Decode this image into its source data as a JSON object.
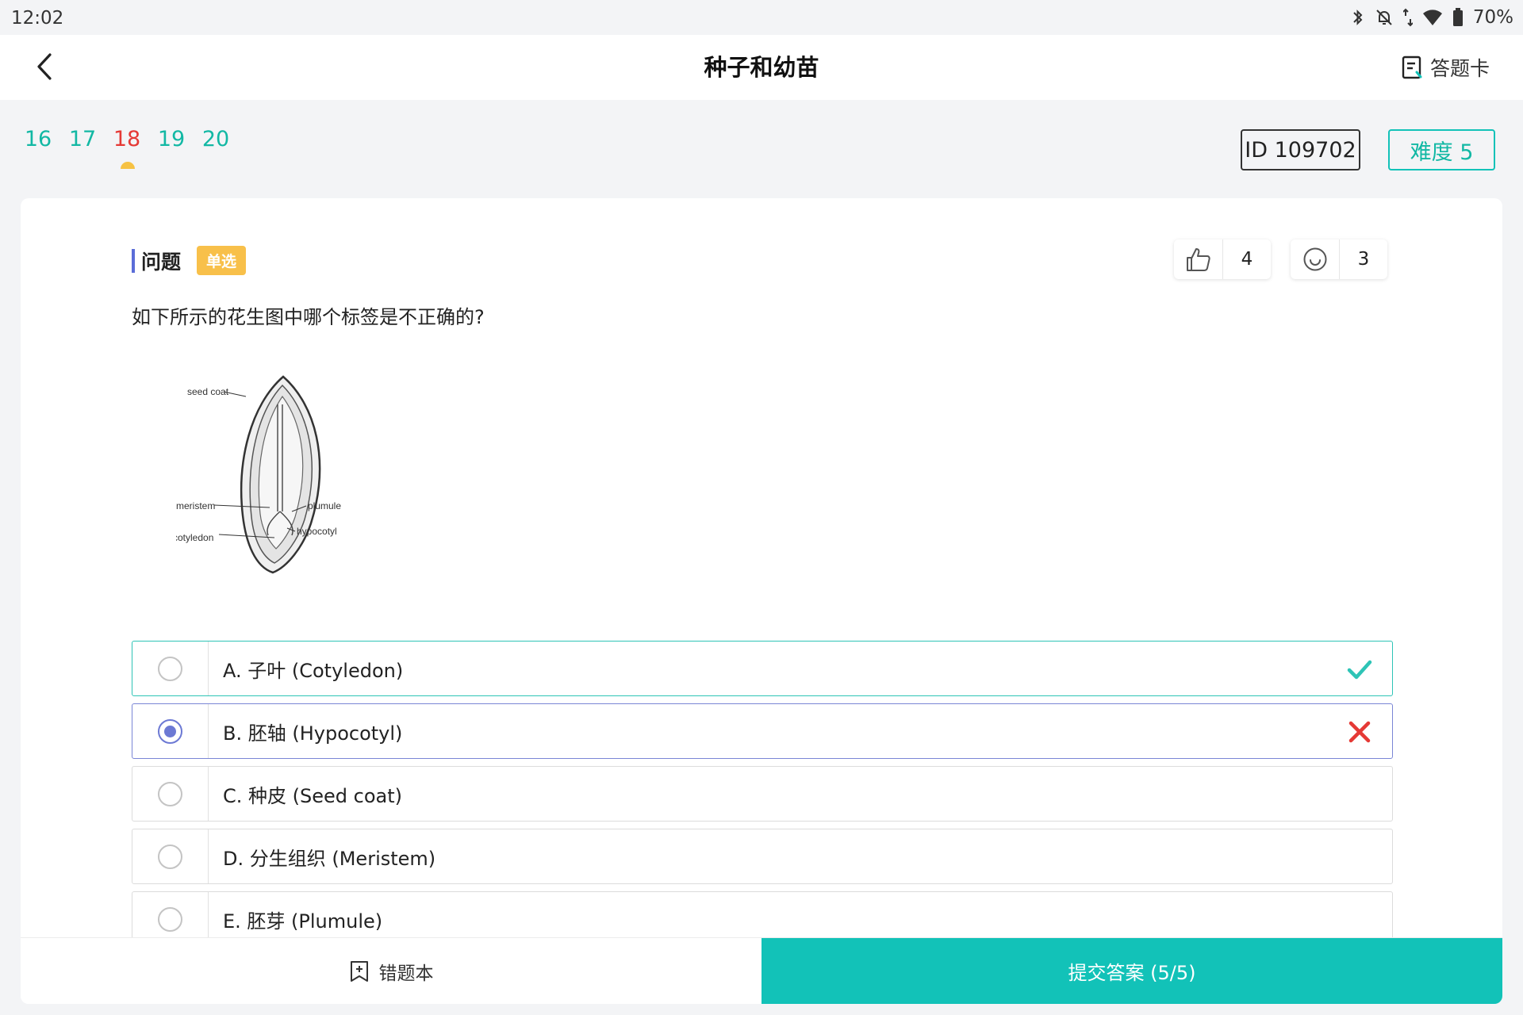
{
  "status_bar": {
    "time": "12:02",
    "battery": "70%",
    "icons": [
      "bluetooth-icon",
      "notifications-off-icon",
      "data-arrows-icon",
      "wifi-icon",
      "battery-icon"
    ]
  },
  "header": {
    "title": "种子和幼苗",
    "answer_card_label": "答题卡"
  },
  "question_nav": {
    "numbers": [
      "16",
      "17",
      "18",
      "19",
      "20"
    ],
    "current": "18"
  },
  "badges": {
    "id_label": "ID 109702",
    "difficulty_label": "难度 5"
  },
  "question": {
    "section_label": "问题",
    "type_label": "单选",
    "likes": "4",
    "smiles": "3",
    "text": "如下所示的花生图中哪个标签是不正确的?",
    "figure_labels": {
      "seed_coat": "seed coat",
      "meristem": "meristem",
      "plumule": "plumule",
      "hypocotyl": "hypocotyl",
      "cotyledon": "cotyledon"
    }
  },
  "options": [
    {
      "text": "A. 子叶 (Cotyledon)",
      "state": "correct",
      "selected": false
    },
    {
      "text": "B. 胚轴 (Hypocotyl)",
      "state": "wrong",
      "selected": true
    },
    {
      "text": "C. 种皮 (Seed coat)",
      "state": "none",
      "selected": false
    },
    {
      "text": "D. 分生组织 (Meristem)",
      "state": "none",
      "selected": false
    },
    {
      "text": "E. 胚芽 (Plumule)",
      "state": "none",
      "selected": false
    }
  ],
  "bottom": {
    "wrong_book_label": "错题本",
    "submit_label": "提交答案 (5/5)"
  },
  "colors": {
    "accent": "#12c2b8",
    "current_question": "#e53935",
    "selected_radio": "#6c79d4",
    "type_badge": "#f8c04a",
    "wrong_mark": "#e53935",
    "correct_mark": "#2ec4b6"
  }
}
